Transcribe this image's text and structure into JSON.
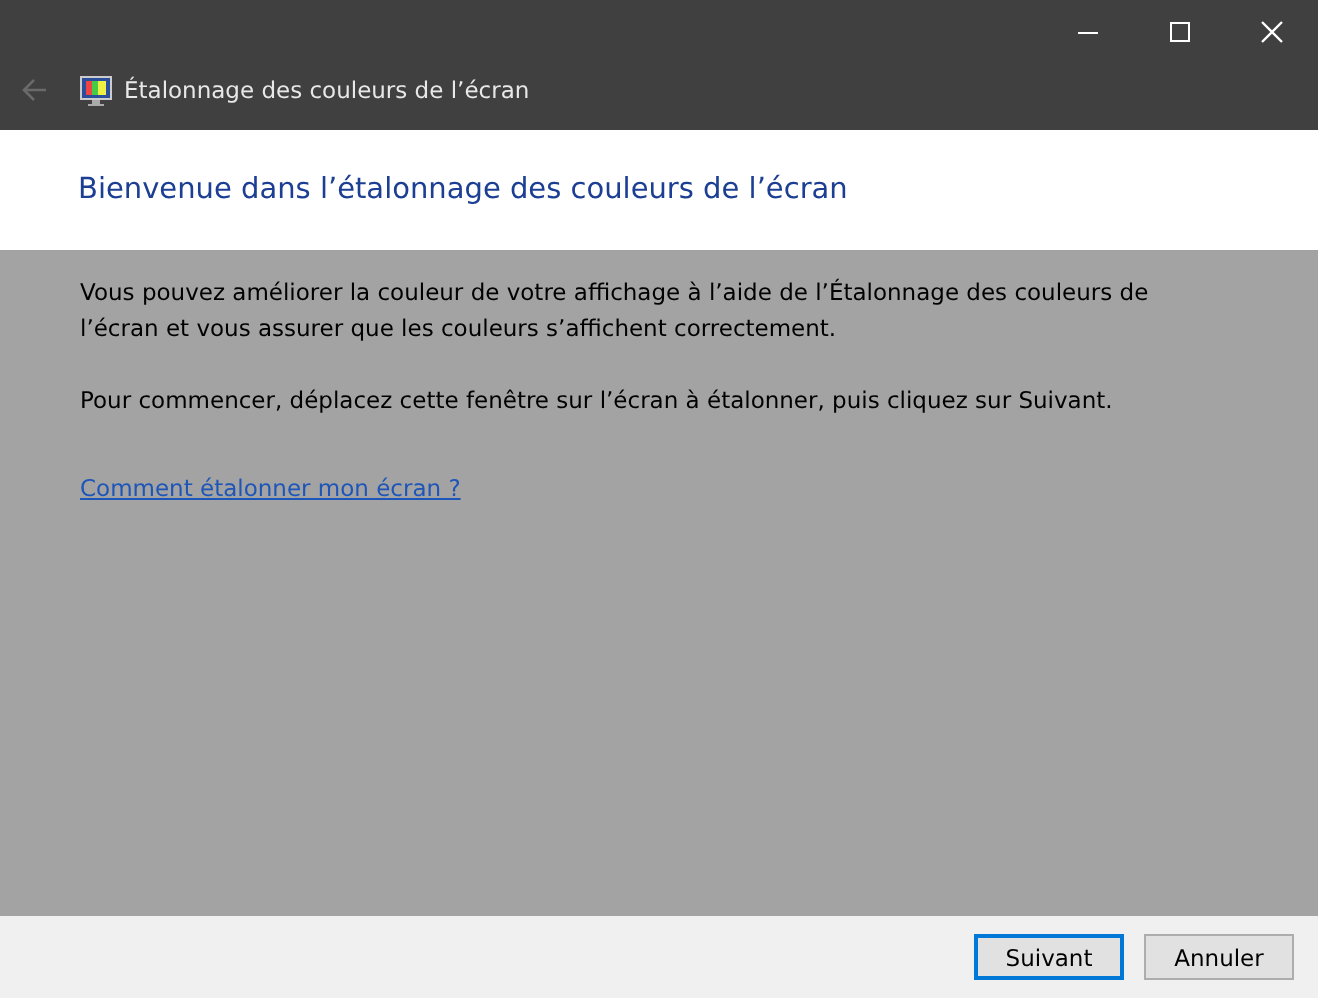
{
  "window": {
    "title": "Étalonnage des couleurs de l’écran",
    "back_disabled": true
  },
  "heading": "Bienvenue dans l’étalonnage des couleurs de l’écran",
  "paragraphs": [
    "Vous pouvez améliorer la couleur de votre affichage à l’aide de l’Étalonnage des couleurs de l’écran et vous assurer que les couleurs s’affichent correctement.",
    "Pour commencer, déplacez cette fenêtre sur l’écran à étalonner, puis cliquez sur Suivant."
  ],
  "link": "Comment étalonner mon écran ?",
  "buttons": [
    {
      "label": "Suivant",
      "default": true
    },
    {
      "label": "Annuler",
      "default": false
    }
  ]
}
